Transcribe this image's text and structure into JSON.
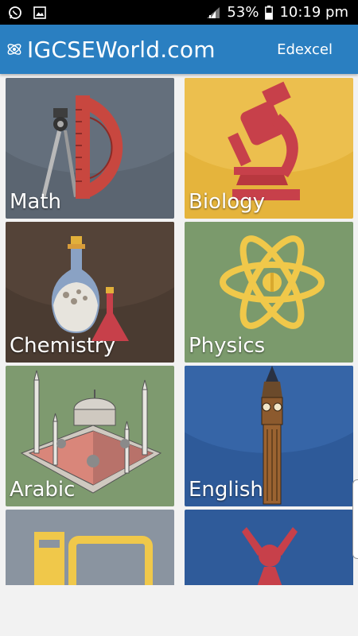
{
  "status_bar": {
    "left_icons": [
      "whatsapp-icon",
      "image-icon"
    ],
    "signal_icon": "signal-icon",
    "battery_percent": "53%",
    "battery_icon": "battery-icon",
    "time": "10:19 pm"
  },
  "app_bar": {
    "logo_icon": "atom-logo-icon",
    "title": "IGCSEWorld.com",
    "action_label": "Edexcel",
    "color": "#2a7fc1"
  },
  "subjects": [
    {
      "label": "Math",
      "icon": "geometry-tools-icon",
      "color": "#5a6470"
    },
    {
      "label": "Biology",
      "icon": "microscope-icon",
      "color": "#e7b63a"
    },
    {
      "label": "Chemistry",
      "icon": "flask-icon",
      "color": "#4b3d33"
    },
    {
      "label": "Physics",
      "icon": "atom-icon",
      "color": "#7b9a6c"
    },
    {
      "label": "Arabic",
      "icon": "mosque-icon",
      "color": "#7e9a6f"
    },
    {
      "label": "English",
      "icon": "big-ben-icon",
      "color": "#2f5b9a"
    },
    {
      "label": "",
      "icon": "books-icon",
      "color": "#8a94a0"
    },
    {
      "label": "",
      "icon": "molecule-icon",
      "color": "#2f5b9a"
    }
  ]
}
